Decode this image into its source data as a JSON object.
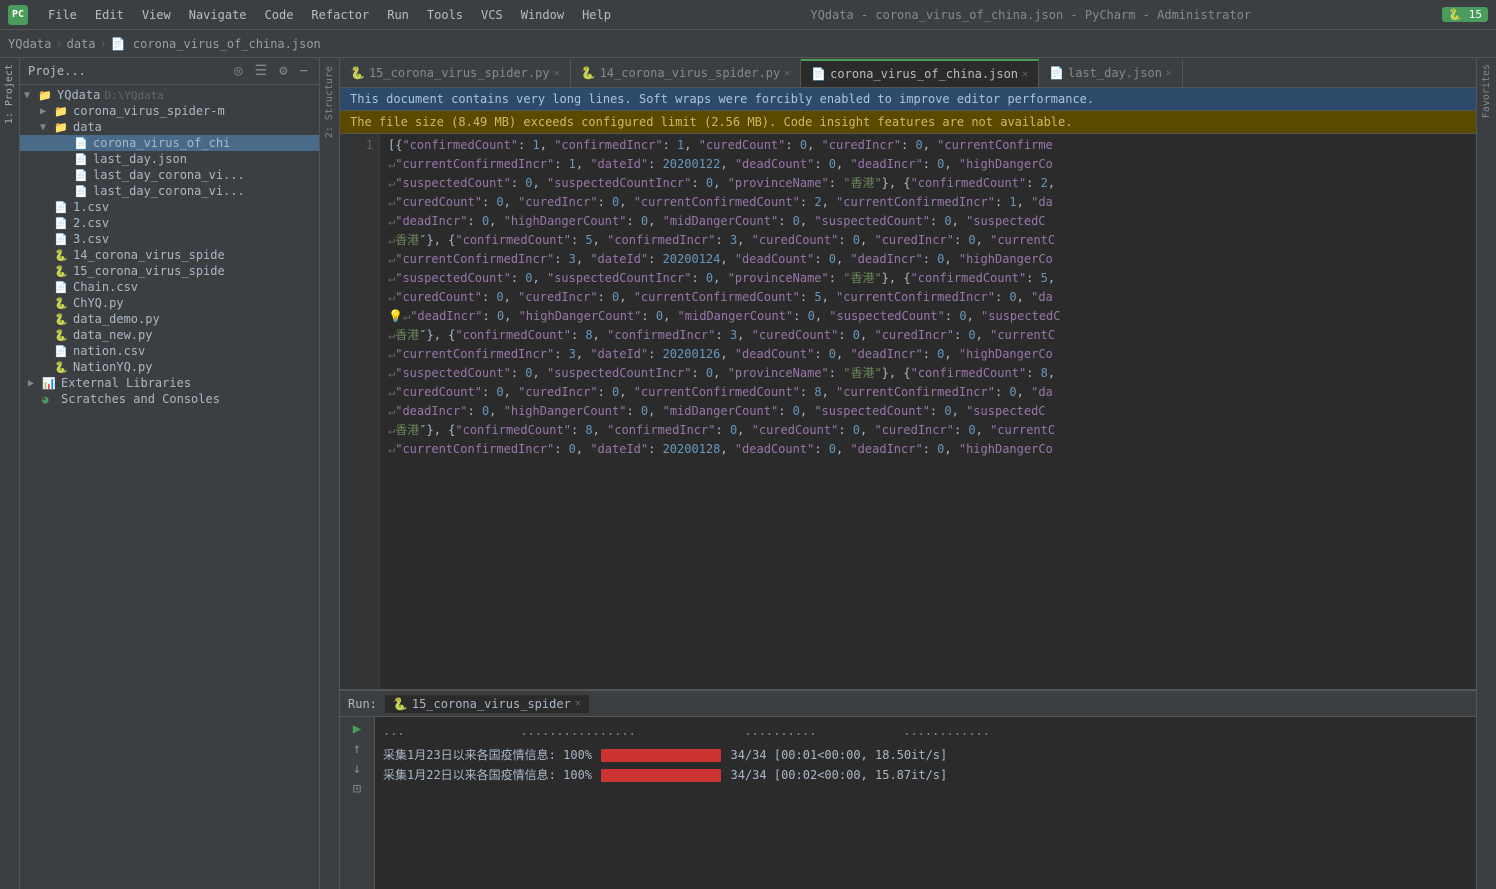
{
  "titleBar": {
    "title": "YQdata - corona_virus_of_china.json - PyCharm - Administrator",
    "menus": [
      "File",
      "Edit",
      "View",
      "Navigate",
      "Code",
      "Refactor",
      "Run",
      "Tools",
      "VCS",
      "Window",
      "Help"
    ],
    "pythonVersion": "15"
  },
  "breadcrumb": {
    "items": [
      "YQdata",
      "data",
      "corona_virus_of_china.json"
    ]
  },
  "projectPanel": {
    "title": "Proje...",
    "rootLabel": "YQdata",
    "rootPath": "D:\\YQdata",
    "items": [
      {
        "label": "corona_virus_spider-m",
        "type": "folder",
        "indent": 1
      },
      {
        "label": "data",
        "type": "folder",
        "indent": 1,
        "expanded": true
      },
      {
        "label": "corona_virus_of_chi",
        "type": "json",
        "indent": 2,
        "selected": true
      },
      {
        "label": "last_day.json",
        "type": "json",
        "indent": 2
      },
      {
        "label": "last_day_corona_vi...",
        "type": "json",
        "indent": 2
      },
      {
        "label": "last_day_corona_vi...",
        "type": "json",
        "indent": 2
      },
      {
        "label": "1.csv",
        "type": "csv",
        "indent": 1
      },
      {
        "label": "2.csv",
        "type": "csv",
        "indent": 1
      },
      {
        "label": "3.csv",
        "type": "csv",
        "indent": 1
      },
      {
        "label": "14_corona_virus_spide",
        "type": "py",
        "indent": 1
      },
      {
        "label": "15_corona_virus_spide",
        "type": "py",
        "indent": 1
      },
      {
        "label": "Chain.csv",
        "type": "csv",
        "indent": 1
      },
      {
        "label": "ChYQ.py",
        "type": "py",
        "indent": 1
      },
      {
        "label": "data_demo.py",
        "type": "py",
        "indent": 1
      },
      {
        "label": "data_new.py",
        "type": "py",
        "indent": 1
      },
      {
        "label": "nation.csv",
        "type": "csv",
        "indent": 1
      },
      {
        "label": "NationYQ.py",
        "type": "py",
        "indent": 1
      },
      {
        "label": "External Libraries",
        "type": "lib",
        "indent": 0
      },
      {
        "label": "Scratches and Consoles",
        "type": "scratch",
        "indent": 0
      }
    ]
  },
  "tabs": [
    {
      "label": "15_corona_virus_spider.py",
      "type": "py",
      "active": false
    },
    {
      "label": "14_corona_virus_spider.py",
      "type": "py",
      "active": false
    },
    {
      "label": "corona_virus_of_china.json",
      "type": "json",
      "active": true
    },
    {
      "label": "last_day.json",
      "type": "json",
      "active": false
    }
  ],
  "notifications": [
    {
      "type": "blue",
      "text": "This document contains very long lines. Soft wraps were forcibly enabled to improve editor performance."
    },
    {
      "type": "yellow",
      "text": "The file size (8.49 MB) exceeds configured limit (2.56 MB). Code insight features are not available."
    }
  ],
  "codeLines": [
    {
      "num": "1",
      "text": "[{\"confirmedCount\": 1, \"confirmedIncr\": 1, \"curedCount\": 0, \"curedIncr\": 0, \"currentConfirme"
    },
    {
      "num": "",
      "text": "  \"currentConfirmedIncr\": 1, \"dateId\": 20200122, \"deadCount\": 0, \"deadIncr\": 0, \"highDangerCo"
    },
    {
      "num": "",
      "text": "  \"suspectedCount\": 0, \"suspectedCountIncr\": 0, \"provinceName\": \"香港\"}, {\"confirmedCount\": 2,"
    },
    {
      "num": "",
      "text": "  \"curedCount\": 0, \"curedIncr\": 0, \"currentConfirmedCount\": 2, \"currentConfirmedIncr\": 1, \"da"
    },
    {
      "num": "",
      "text": "  \"deadIncr\": 0, \"highDangerCount\": 0, \"midDangerCount\": 0, \"suspectedCount\": 0, \"suspectedC"
    },
    {
      "num": "",
      "text": "  香港\"}, {\"confirmedCount\": 5, \"confirmedIncr\": 3, \"curedCount\": 0, \"curedIncr\": 0, \"currentC"
    },
    {
      "num": "",
      "text": "  \"currentConfirmedIncr\": 3, \"dateId\": 20200124, \"deadCount\": 0, \"deadIncr\": 0, \"highDangerCo"
    },
    {
      "num": "",
      "text": "  \"suspectedCount\": 0, \"suspectedCountIncr\": 0, \"provinceName\": \"香港\"}, {\"confirmedCount\": 5,"
    },
    {
      "num": "",
      "text": "  \"curedCount\": 0, \"curedIncr\": 0, \"currentConfirmedCount\": 5, \"currentConfirmedIncr\": 0, \"da"
    },
    {
      "num": "",
      "text": "  \"deadIncr\": 0, \"highDangerCount\": 0, \"midDangerCount\": 0, \"suspectedCount\": 0, \"suspectedC"
    },
    {
      "num": "",
      "text": "  香港\"}, {\"confirmedCount\": 8, \"confirmedIncr\": 3, \"curedCount\": 0, \"curedIncr\": 0, \"currentC"
    },
    {
      "num": "",
      "text": "  \"currentConfirmedIncr\": 3, \"dateId\": 20200126, \"deadCount\": 0, \"deadIncr\": 0, \"highDangerCo"
    },
    {
      "num": "",
      "text": "  \"suspectedCount\": 0, \"suspectedCountIncr\": 0, \"provinceName\": \"香港\"}, {\"confirmedCount\": 8,"
    },
    {
      "num": "",
      "text": "  \"curedCount\": 0, \"curedIncr\": 0, \"currentConfirmedCount\": 8, \"currentConfirmedIncr\": 0, \"da"
    },
    {
      "num": "",
      "text": "  \"deadIncr\": 0, \"highDangerCount\": 0, \"midDangerCount\": 0, \"suspectedCount\": 0, \"suspectedC"
    },
    {
      "num": "",
      "text": "  香港\"}, {\"confirmedCount\": 8, \"confirmedIncr\": 0, \"curedCount\": 0, \"curedIncr\": 0, \"currentC"
    },
    {
      "num": "",
      "text": "  \"currentConfirmedIncr\": 0, \"dateId\": 20200128, \"deadCount\": 0, \"deadIncr\": 0, \"highDangerCo"
    }
  ],
  "bottomPanel": {
    "runLabel": "Run:",
    "runTab": "15_corona_virus_spider",
    "outputLines": [
      {
        "text": "采集1月23日以来各国疫情信息: 100%|████████████| 34/34 [00:01<00:00, 18.50it/s]",
        "progress": 100
      },
      {
        "text": "采集1月22日以来各国疫情信息: 100%|████████████| 34/34 [00:02<00:00, 15.87it/s]",
        "progress": 100
      }
    ]
  },
  "sideLabels": {
    "project": "1: Project",
    "structure": "2: Structure",
    "favorites": "Favorites"
  }
}
